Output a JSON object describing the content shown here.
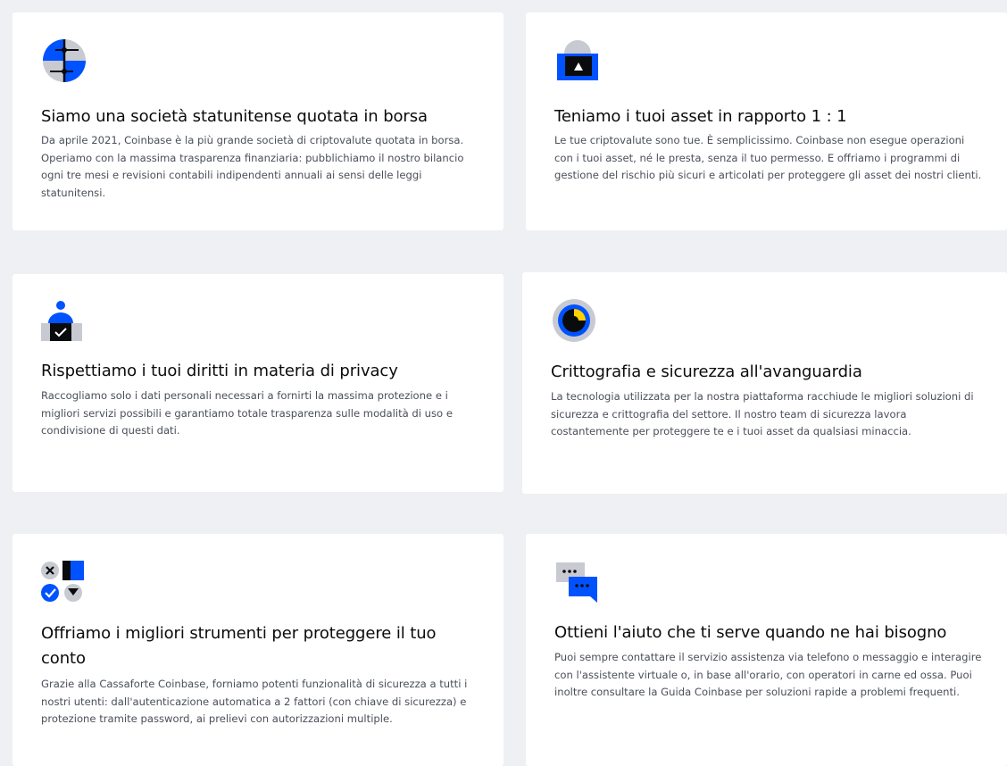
{
  "colors": {
    "background": "#eef0f3",
    "card": "#ffffff",
    "accent_blue": "#0052ff",
    "icon_gray": "#c7cad1",
    "icon_dark": "#0a0b0d",
    "icon_yellow": "#ffd200"
  },
  "cards": [
    {
      "icon": "public-company-icon",
      "title": "Siamo una società statunitense quotata in borsa",
      "body": "Da aprile 2021, Coinbase è la più grande società di criptovalute quotata in borsa. Operiamo con la massima trasparenza finanziaria: pubblichiamo il nostro bilancio ogni tre mesi e revisioni contabili indipendenti annuali ai sensi delle leggi statunitensi."
    },
    {
      "icon": "asset-vault-icon",
      "title": "Teniamo i tuoi asset in rapporto 1 : 1",
      "body": "Le tue criptovalute sono tue. È semplicissimo. Coinbase non esegue operazioni con i tuoi asset, né le presta, senza il tuo permesso. E offriamo i programmi di gestione del rischio più sicuri e articolati per proteggere gli asset dei nostri clienti."
    },
    {
      "icon": "privacy-user-icon",
      "title": "Rispettiamo i tuoi diritti in materia di privacy",
      "body": "Raccogliamo solo i dati personali necessari a fornirti la massima protezione e i migliori servizi possibili e garantiamo totale trasparenza sulle modalità di uso e condivisione di questi dati."
    },
    {
      "icon": "encryption-icon",
      "title": "Crittografia e sicurezza all'avanguardia",
      "body": "La tecnologia utilizzata per la nostra piattaforma racchiude le migliori soluzioni di sicurezza e crittografia del settore. Il nostro team di sicurezza lavora costantemente per proteggere te e i tuoi asset da qualsiasi minaccia."
    },
    {
      "icon": "security-tools-icon",
      "title": "Offriamo i migliori strumenti per proteggere il tuo conto",
      "body": "Grazie alla Cassaforte Coinbase, forniamo potenti funzionalità di sicurezza a tutti i nostri utenti: dall'autenticazione automatica a 2 fattori (con chiave di sicurezza) e protezione tramite password, ai prelievi con autorizzazioni multiple."
    },
    {
      "icon": "support-chat-icon",
      "title": "Ottieni l'aiuto che ti serve quando ne hai bisogno",
      "body": "Puoi sempre contattare il servizio assistenza via telefono o messaggio e interagire con l'assistente virtuale o, in base all'orario, con operatori in carne ed ossa. Puoi inoltre consultare la Guida Coinbase per soluzioni rapide a problemi frequenti."
    }
  ]
}
